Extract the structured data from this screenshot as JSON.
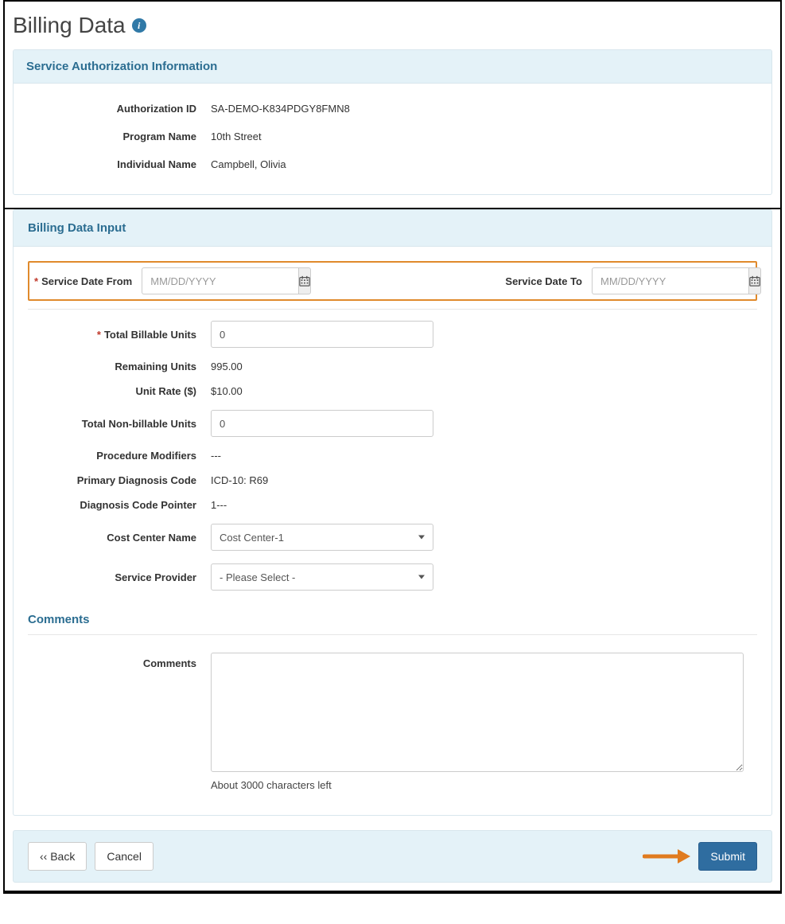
{
  "page": {
    "title": "Billing Data"
  },
  "auth_panel": {
    "heading": "Service Authorization Information",
    "rows": {
      "authorization_id": {
        "label": "Authorization ID",
        "value": "SA-DEMO-K834PDGY8FMN8"
      },
      "program_name": {
        "label": "Program Name",
        "value": "10th Street"
      },
      "individual_name": {
        "label": "Individual Name",
        "value": "Campbell, Olivia"
      }
    }
  },
  "input_panel": {
    "heading": "Billing Data Input",
    "service_date_from": {
      "label": "Service Date From",
      "placeholder": "MM/DD/YYYY",
      "value": ""
    },
    "service_date_to": {
      "label": "Service Date To",
      "placeholder": "MM/DD/YYYY",
      "value": ""
    },
    "total_billable": {
      "label": "Total Billable Units",
      "value": "0"
    },
    "remaining_units": {
      "label": "Remaining Units",
      "value": "995.00"
    },
    "unit_rate": {
      "label": "Unit Rate ($)",
      "value": "$10.00"
    },
    "total_nonbillable": {
      "label": "Total Non-billable Units",
      "value": "0"
    },
    "procedure_modifiers": {
      "label": "Procedure Modifiers",
      "value": "---"
    },
    "primary_diagnosis": {
      "label": "Primary Diagnosis Code",
      "value": "ICD-10: R69"
    },
    "diagnosis_pointer": {
      "label": "Diagnosis Code Pointer",
      "value": "1---"
    },
    "cost_center": {
      "label": "Cost Center Name",
      "selected": "Cost Center-1"
    },
    "service_provider": {
      "label": "Service Provider",
      "selected": "- Please Select -"
    }
  },
  "comments_section": {
    "heading": "Comments",
    "label": "Comments",
    "value": "",
    "hint": "About 3000 characters left"
  },
  "footer": {
    "back": "‹‹ Back",
    "cancel": "Cancel",
    "submit": "Submit"
  }
}
